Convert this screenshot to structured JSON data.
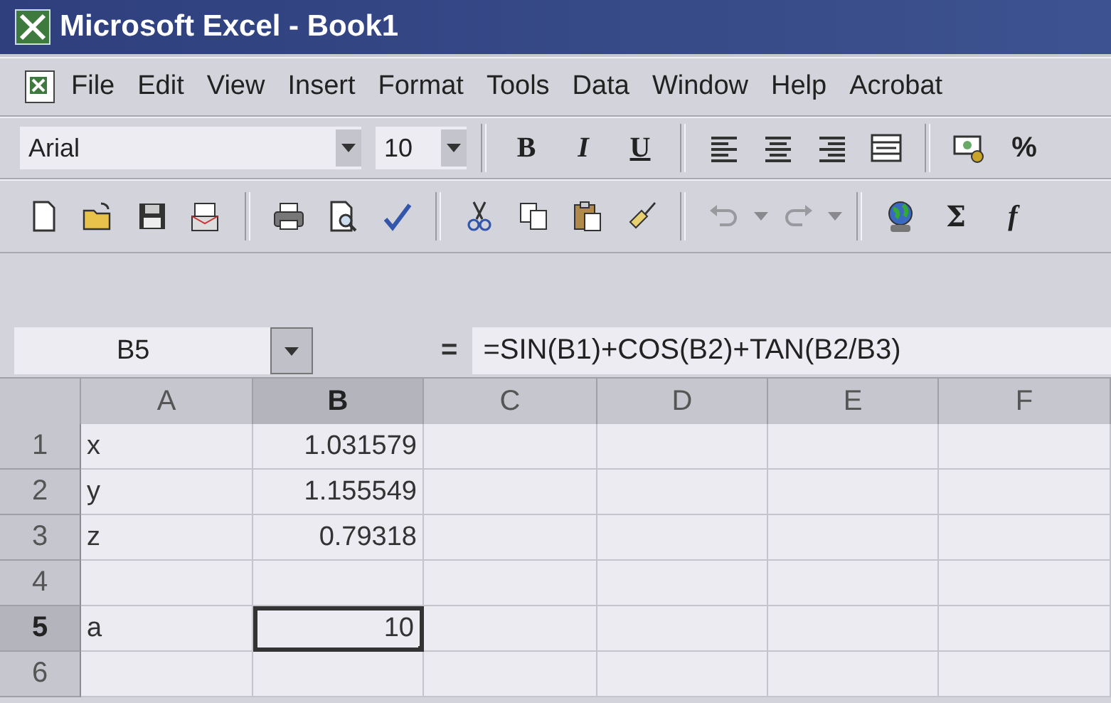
{
  "window": {
    "title": "Microsoft Excel - Book1"
  },
  "menu": [
    {
      "label": "File"
    },
    {
      "label": "Edit"
    },
    {
      "label": "View"
    },
    {
      "label": "Insert"
    },
    {
      "label": "Format"
    },
    {
      "label": "Tools"
    },
    {
      "label": "Data"
    },
    {
      "label": "Window"
    },
    {
      "label": "Help"
    },
    {
      "label": "Acrobat"
    }
  ],
  "formatting_toolbar": {
    "font": "Arial",
    "font_size": "10",
    "bold": "B",
    "italic": "I",
    "underline": "U",
    "percent": "%"
  },
  "standard_toolbar": {
    "undo": {
      "disabled": true
    },
    "redo": {
      "disabled": true
    },
    "autosum": "Σ",
    "function": "f"
  },
  "formula_bar": {
    "name_box": "B5",
    "equals": "=",
    "formula": "=SIN(B1)+COS(B2)+TAN(B2/B3)"
  },
  "grid": {
    "columns": [
      {
        "label": "A",
        "selected": false
      },
      {
        "label": "B",
        "selected": true
      },
      {
        "label": "C",
        "selected": false
      },
      {
        "label": "D",
        "selected": false
      },
      {
        "label": "E",
        "selected": false
      },
      {
        "label": "F",
        "selected": false
      }
    ],
    "rows": [
      {
        "header": "1",
        "selected": false,
        "cells": [
          {
            "value": "x",
            "kind": "text",
            "selected": false
          },
          {
            "value": "1.031579",
            "kind": "number",
            "selected": false
          }
        ]
      },
      {
        "header": "2",
        "selected": false,
        "cells": [
          {
            "value": "y",
            "kind": "text",
            "selected": false
          },
          {
            "value": "1.155549",
            "kind": "number",
            "selected": false
          }
        ]
      },
      {
        "header": "3",
        "selected": false,
        "cells": [
          {
            "value": "z",
            "kind": "text",
            "selected": false
          },
          {
            "value": "0.79318",
            "kind": "number",
            "selected": false
          }
        ]
      },
      {
        "header": "4",
        "selected": false
      },
      {
        "header": "5",
        "selected": true,
        "cells": [
          {
            "value": "a",
            "kind": "text",
            "selected": false
          },
          {
            "value": "10",
            "kind": "number",
            "selected": true
          }
        ]
      },
      {
        "header": "6",
        "selected": false
      }
    ]
  }
}
